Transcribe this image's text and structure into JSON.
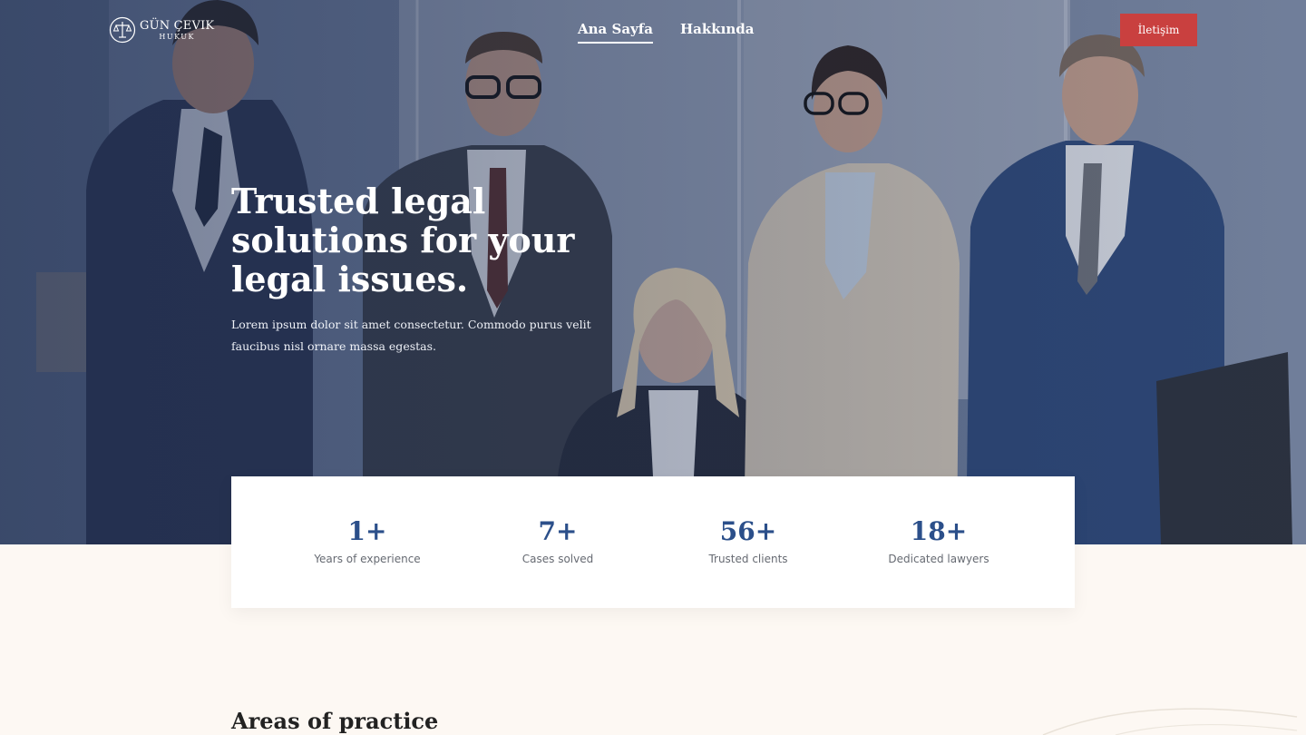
{
  "brand": {
    "name": "GÜN ÇEVIK",
    "sub": "HUKUK",
    "logo_icon": "scales-of-justice-icon"
  },
  "nav": {
    "items": [
      {
        "label": "Ana Sayfa",
        "active": true
      },
      {
        "label": "Hakkında",
        "active": false
      }
    ]
  },
  "contact_button": {
    "label": "İletişim",
    "color": "#c9403f"
  },
  "hero": {
    "title": "Trusted legal solutions for your legal issues.",
    "description": "Lorem ipsum dolor sit amet consectetur. Commodo purus velit faucibus nisl ornare massa egestas."
  },
  "stats": [
    {
      "value": "1+",
      "label": "Years of experience"
    },
    {
      "value": "7+",
      "label": "Cases solved"
    },
    {
      "value": "56+",
      "label": "Trusted clients"
    },
    {
      "value": "18+",
      "label": "Dedicated lawyers"
    }
  ],
  "section": {
    "title": "Areas of practice"
  },
  "colors": {
    "accent": "#2b4f8a",
    "cta": "#c9403f",
    "page_bg": "#fdf8f3"
  }
}
